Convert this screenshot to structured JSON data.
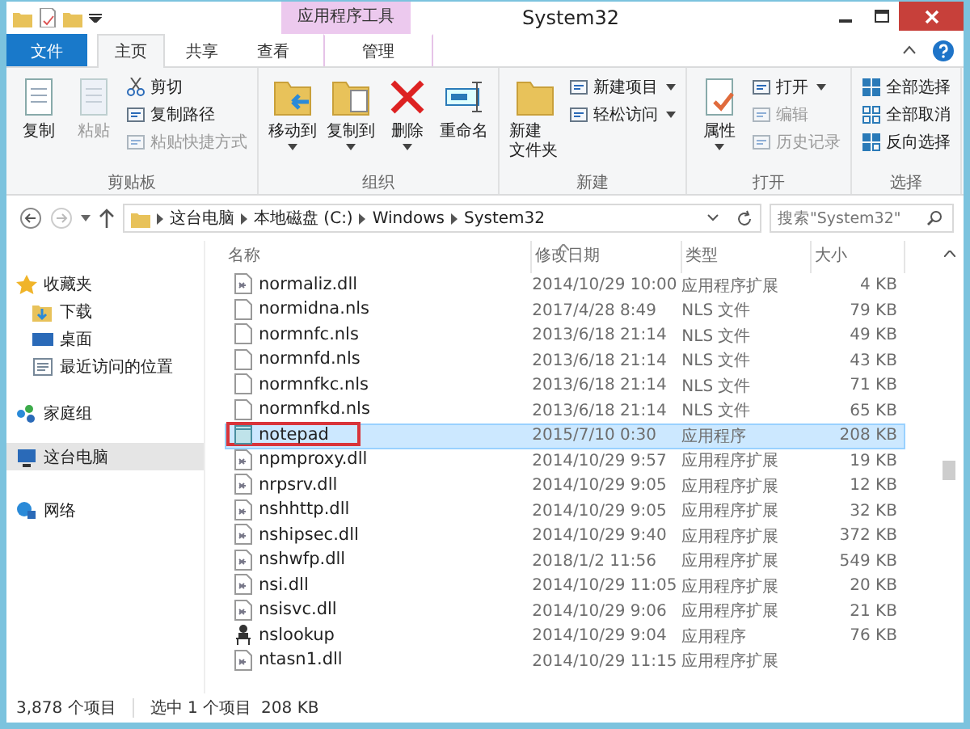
{
  "window": {
    "context_tab": "应用程序工具",
    "title": "System32"
  },
  "tabs": [
    {
      "label": "文件",
      "kind": "file",
      "selected": false
    },
    {
      "label": "主页",
      "kind": "normal",
      "selected": true
    },
    {
      "label": "共享",
      "kind": "normal",
      "selected": false
    },
    {
      "label": "查看",
      "kind": "normal",
      "selected": false
    },
    {
      "label": "管理",
      "kind": "context",
      "selected": false
    }
  ],
  "ribbon": {
    "groups": [
      {
        "label": "剪贴板",
        "commands": [
          {
            "label": "复制",
            "kind": "large",
            "disabled": false,
            "dropdown": false
          },
          {
            "label": "粘贴",
            "kind": "large",
            "disabled": true,
            "dropdown": false
          },
          {
            "label": "剪切",
            "kind": "small",
            "disabled": false,
            "dropdown": false
          },
          {
            "label": "复制路径",
            "kind": "small",
            "disabled": false,
            "dropdown": false
          },
          {
            "label": "粘贴快捷方式",
            "kind": "small",
            "disabled": true,
            "dropdown": false
          }
        ]
      },
      {
        "label": "组织",
        "commands": [
          {
            "label": "移动到",
            "kind": "large",
            "disabled": false,
            "dropdown": true
          },
          {
            "label": "复制到",
            "kind": "large",
            "disabled": false,
            "dropdown": true
          },
          {
            "label": "删除",
            "kind": "large",
            "disabled": false,
            "dropdown": true
          },
          {
            "label": "重命名",
            "kind": "large",
            "disabled": false,
            "dropdown": false
          }
        ]
      },
      {
        "label": "新建",
        "commands": [
          {
            "label": "新建文件夹",
            "kind": "large",
            "disabled": false,
            "dropdown": false
          },
          {
            "label": "新建项目",
            "kind": "small",
            "disabled": false,
            "dropdown": true
          },
          {
            "label": "轻松访问",
            "kind": "small",
            "disabled": false,
            "dropdown": true
          }
        ]
      },
      {
        "label": "打开",
        "commands": [
          {
            "label": "属性",
            "kind": "large",
            "disabled": false,
            "dropdown": true
          },
          {
            "label": "打开",
            "kind": "small",
            "disabled": false,
            "dropdown": true
          },
          {
            "label": "编辑",
            "kind": "small",
            "disabled": true,
            "dropdown": false
          },
          {
            "label": "历史记录",
            "kind": "small",
            "disabled": true,
            "dropdown": false
          }
        ]
      },
      {
        "label": "选择",
        "commands": [
          {
            "label": "全部选择",
            "kind": "small",
            "disabled": false,
            "dropdown": false
          },
          {
            "label": "全部取消",
            "kind": "small",
            "disabled": false,
            "dropdown": false
          },
          {
            "label": "反向选择",
            "kind": "small",
            "disabled": false,
            "dropdown": false
          }
        ]
      }
    ]
  },
  "address": {
    "crumbs": [
      "这台电脑",
      "本地磁盘 (C:)",
      "Windows",
      "System32"
    ],
    "search_placeholder": "搜索\"System32\""
  },
  "navigation": [
    {
      "label": "收藏夹",
      "kind": "favorites",
      "selected": false,
      "children": [
        {
          "label": "下载",
          "kind": "downloads",
          "selected": false
        },
        {
          "label": "桌面",
          "kind": "desktop",
          "selected": false
        },
        {
          "label": "最近访问的位置",
          "kind": "recent",
          "selected": false
        }
      ]
    },
    {
      "label": "家庭组",
      "kind": "homegroup",
      "selected": false
    },
    {
      "label": "这台电脑",
      "kind": "computer",
      "selected": true
    },
    {
      "label": "网络",
      "kind": "network",
      "selected": false
    }
  ],
  "table": {
    "columns": [
      "名称",
      "修改日期",
      "类型",
      "大小"
    ],
    "rows": [
      {
        "name": "normaliz.dll",
        "kind": "dll",
        "date": "2014/10/29 10:00",
        "type": "应用程序扩展",
        "size": "4 KB",
        "selected": false,
        "highlighted": false
      },
      {
        "name": "normidna.nls",
        "kind": "nls",
        "date": "2017/4/28 8:49",
        "type": "NLS 文件",
        "size": "79 KB",
        "selected": false,
        "highlighted": false
      },
      {
        "name": "normnfc.nls",
        "kind": "nls",
        "date": "2013/6/18 21:14",
        "type": "NLS 文件",
        "size": "49 KB",
        "selected": false,
        "highlighted": false
      },
      {
        "name": "normnfd.nls",
        "kind": "nls",
        "date": "2013/6/18 21:14",
        "type": "NLS 文件",
        "size": "43 KB",
        "selected": false,
        "highlighted": false
      },
      {
        "name": "normnfkc.nls",
        "kind": "nls",
        "date": "2013/6/18 21:14",
        "type": "NLS 文件",
        "size": "71 KB",
        "selected": false,
        "highlighted": false
      },
      {
        "name": "normnfkd.nls",
        "kind": "nls",
        "date": "2013/6/18 21:14",
        "type": "NLS 文件",
        "size": "65 KB",
        "selected": false,
        "highlighted": false
      },
      {
        "name": "notepad",
        "kind": "app",
        "date": "2015/7/10 0:30",
        "type": "应用程序",
        "size": "208 KB",
        "selected": true,
        "highlighted": true
      },
      {
        "name": "npmproxy.dll",
        "kind": "dll",
        "date": "2014/10/29 9:57",
        "type": "应用程序扩展",
        "size": "19 KB",
        "selected": false,
        "highlighted": false
      },
      {
        "name": "nrpsrv.dll",
        "kind": "dll",
        "date": "2014/10/29 9:05",
        "type": "应用程序扩展",
        "size": "12 KB",
        "selected": false,
        "highlighted": false
      },
      {
        "name": "nshhttp.dll",
        "kind": "dll",
        "date": "2014/10/29 9:05",
        "type": "应用程序扩展",
        "size": "32 KB",
        "selected": false,
        "highlighted": false
      },
      {
        "name": "nshipsec.dll",
        "kind": "dll",
        "date": "2014/10/29 9:40",
        "type": "应用程序扩展",
        "size": "372 KB",
        "selected": false,
        "highlighted": false
      },
      {
        "name": "nshwfp.dll",
        "kind": "dll",
        "date": "2018/1/2 11:56",
        "type": "应用程序扩展",
        "size": "549 KB",
        "selected": false,
        "highlighted": false
      },
      {
        "name": "nsi.dll",
        "kind": "dll",
        "date": "2014/10/29 11:05",
        "type": "应用程序扩展",
        "size": "20 KB",
        "selected": false,
        "highlighted": false
      },
      {
        "name": "nsisvc.dll",
        "kind": "dll",
        "date": "2014/10/29 9:06",
        "type": "应用程序扩展",
        "size": "21 KB",
        "selected": false,
        "highlighted": false
      },
      {
        "name": "nslookup",
        "kind": "exe",
        "date": "2014/10/29 9:04",
        "type": "应用程序",
        "size": "76 KB",
        "selected": false,
        "highlighted": false
      },
      {
        "name": "ntasn1.dll",
        "kind": "dll",
        "date": "2014/10/29 11:15",
        "type": "应用程序扩展",
        "selected": false,
        "highlighted": false
      }
    ]
  },
  "status_bar": {
    "count": "3,878 个项目",
    "selection": "选中 1 个项目",
    "selection_size": "208 KB"
  }
}
